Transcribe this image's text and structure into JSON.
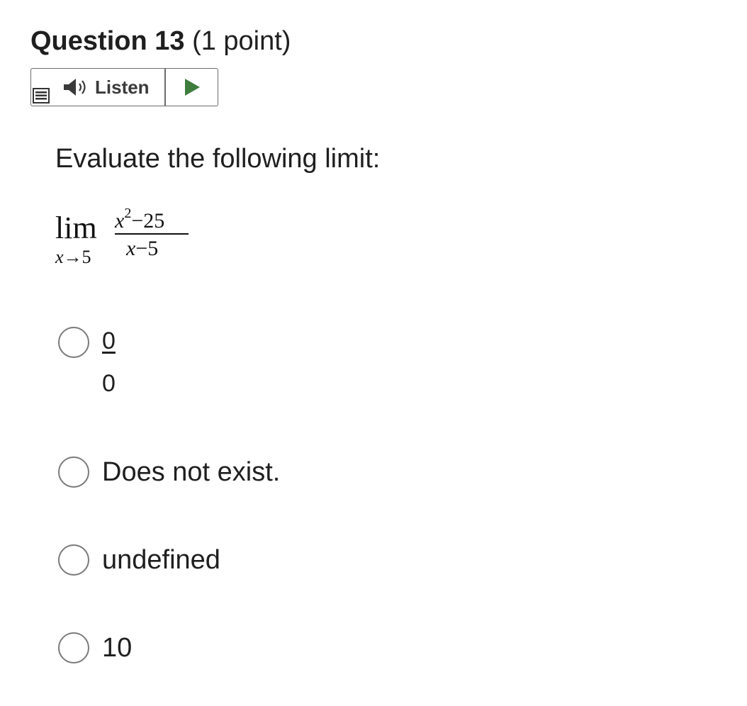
{
  "question": {
    "title": "Question 13",
    "points": "(1 point)"
  },
  "listen_toolbar": {
    "menu_icon": "menu-icon",
    "speaker_icon": "speaker-icon",
    "listen_label": "Listen",
    "play_icon": "play-icon",
    "play_color": "#3e7d3e"
  },
  "prompt": "Evaluate the following limit:",
  "math": {
    "lim": "lim",
    "sub_var": "x",
    "sub_arrow": "→",
    "sub_value": "5",
    "num_var": "x",
    "num_exp": "2",
    "num_rest": "−25",
    "den_var": "x",
    "den_rest": "−5"
  },
  "options": [
    {
      "numerator": "0",
      "denominator": "0"
    },
    {
      "label": "Does not exist."
    },
    {
      "label": "undefined"
    },
    {
      "label": "10"
    }
  ]
}
